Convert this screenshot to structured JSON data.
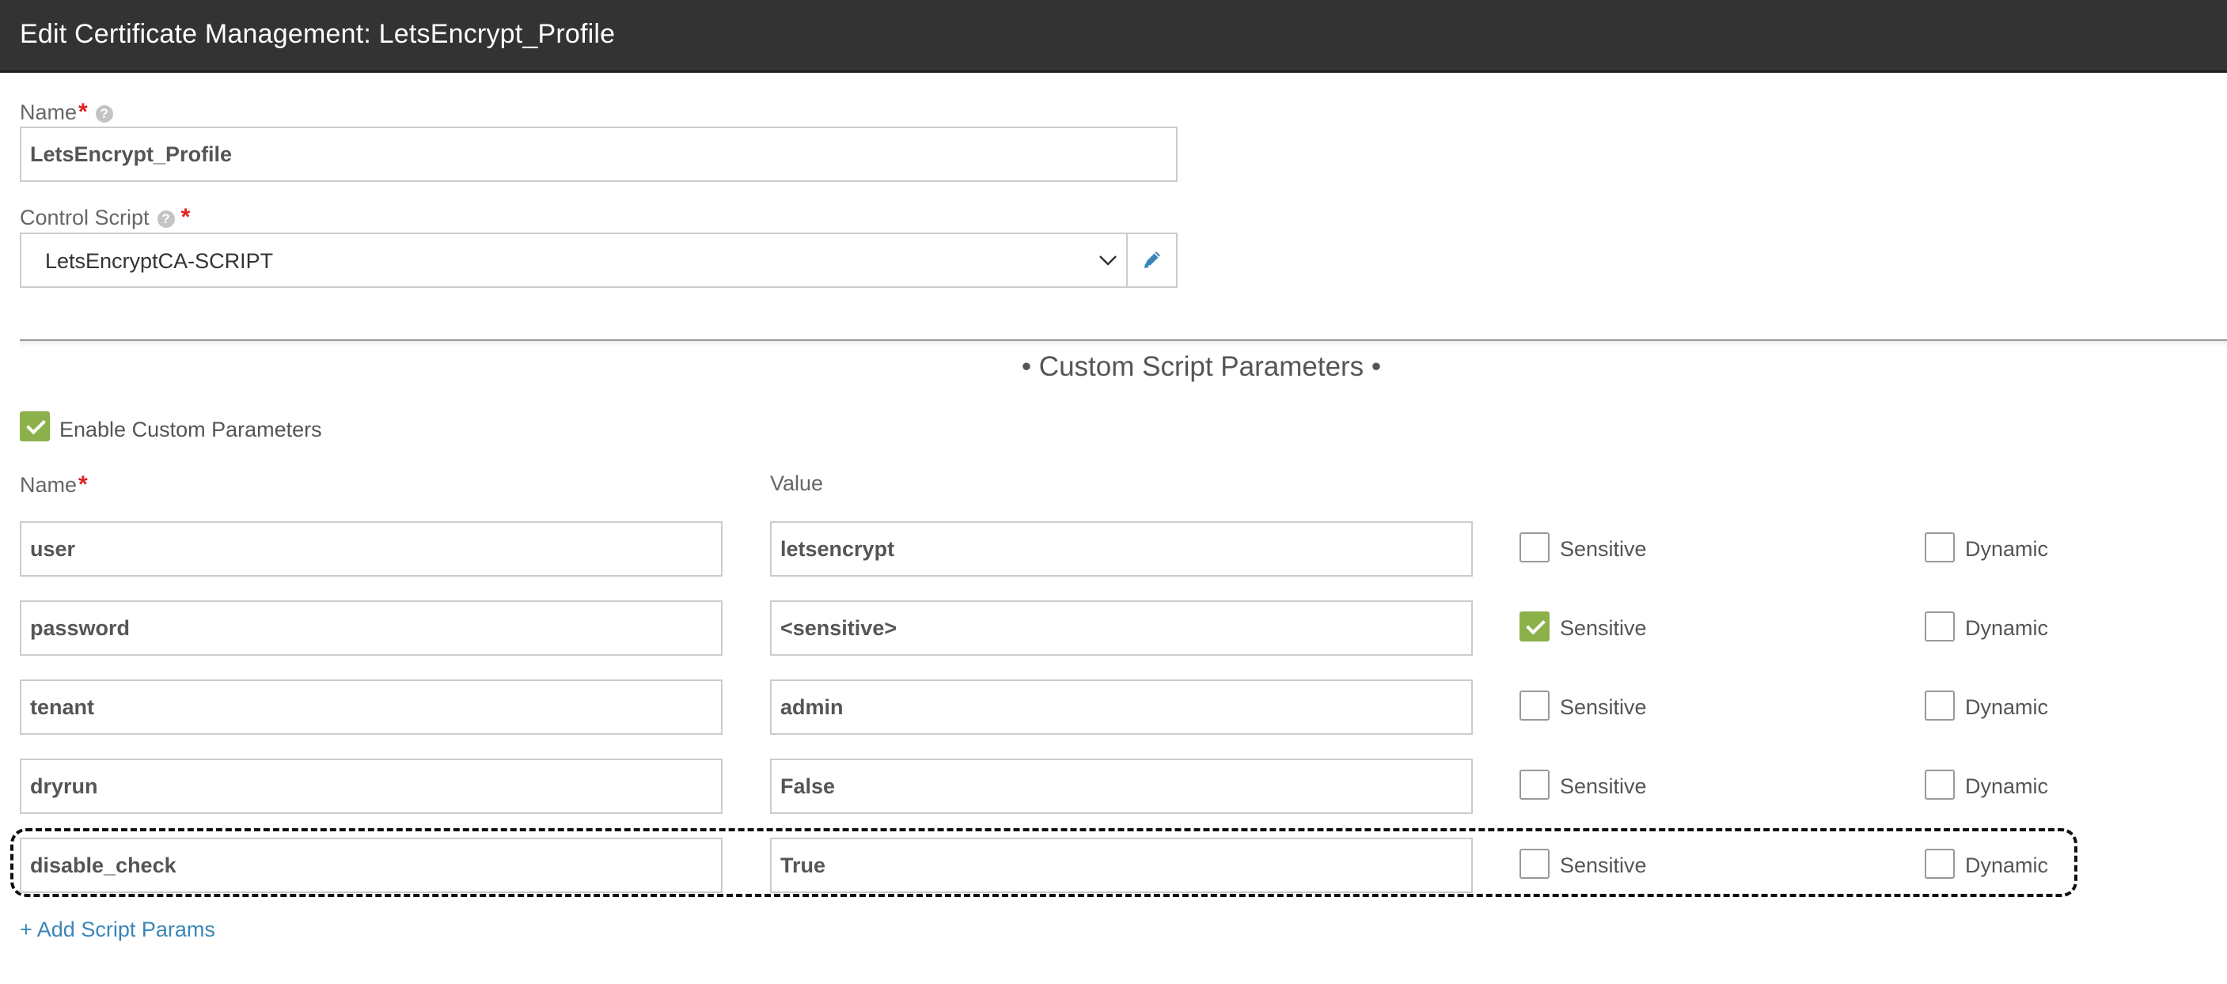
{
  "header": {
    "title": "Edit Certificate Management: LetsEncrypt_Profile"
  },
  "form": {
    "name_label": "Name",
    "name_value": "LetsEncrypt_Profile",
    "control_script_label": "Control Script",
    "control_script_value": "LetsEncryptCA-SCRIPT",
    "required_marker": "*",
    "help_glyph": "?"
  },
  "custom_params": {
    "section_title": "• Custom Script Parameters •",
    "enable_label": "Enable Custom Parameters",
    "enable_checked": true,
    "col_name": "Name",
    "col_value": "Value",
    "sensitive_label": "Sensitive",
    "dynamic_label": "Dynamic",
    "rows": [
      {
        "name": "user",
        "value": "letsencrypt",
        "sensitive": false,
        "dynamic": false
      },
      {
        "name": "password",
        "value": "<sensitive>",
        "sensitive": true,
        "dynamic": false
      },
      {
        "name": "tenant",
        "value": "admin",
        "sensitive": false,
        "dynamic": false
      },
      {
        "name": "dryrun",
        "value": "False",
        "sensitive": false,
        "dynamic": false
      },
      {
        "name": "disable_check",
        "value": "True",
        "sensitive": false,
        "dynamic": false
      }
    ],
    "add_link": "+ Add Script Params"
  },
  "colors": {
    "accent_green": "#8cb04a",
    "link_blue": "#3a86b8",
    "header_bg": "#333333",
    "required_red": "#e02020"
  },
  "icons": {
    "dropdown": "chevron-down-icon",
    "edit": "pencil-icon",
    "help": "help-circle-icon",
    "check": "checkmark-icon"
  }
}
